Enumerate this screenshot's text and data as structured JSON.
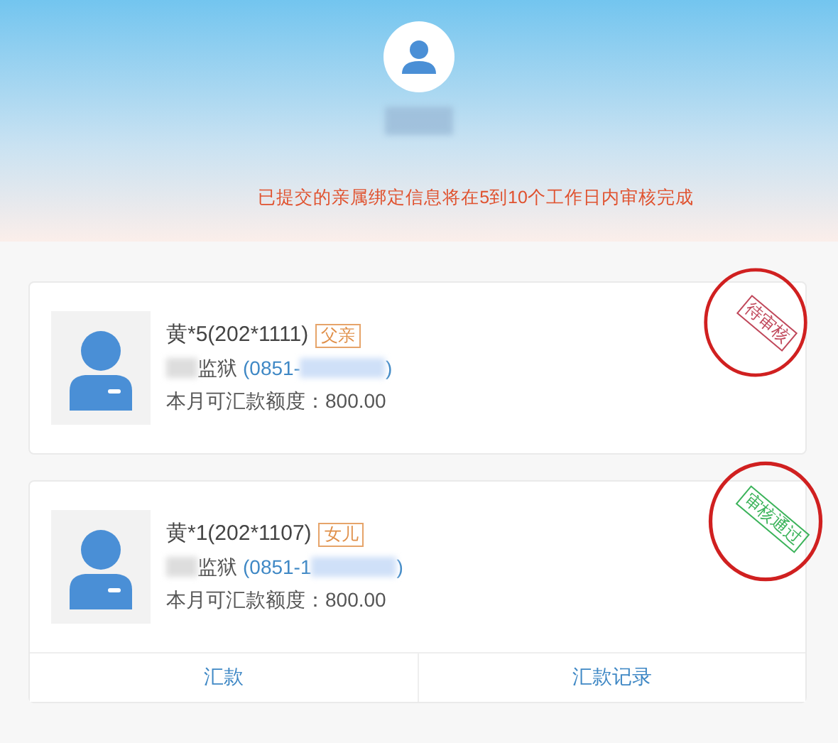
{
  "header": {
    "notice": "已提交的亲属绑定信息将在5到10个工作日内审核完成"
  },
  "relatives": [
    {
      "name": "黄*5(202*1111)",
      "relation": "父亲",
      "prison": "监狱",
      "phone_start": "(0851-",
      "phone_end": ")",
      "quota_label": "本月可汇款额度：",
      "quota": "800.00",
      "status": {
        "kind": "pending",
        "text": "待审核",
        "color": "#c0475a"
      }
    },
    {
      "name": "黄*1(202*1107)",
      "relation": "女儿",
      "prison": "监狱",
      "phone_start": "(0851-1",
      "phone_end": ")",
      "quota_label": "本月可汇款额度：",
      "quota": "800.00",
      "status": {
        "kind": "approved",
        "text": "审核通过",
        "color": "#3bb35a"
      },
      "actions": [
        "汇款",
        "汇款记录"
      ]
    }
  ]
}
